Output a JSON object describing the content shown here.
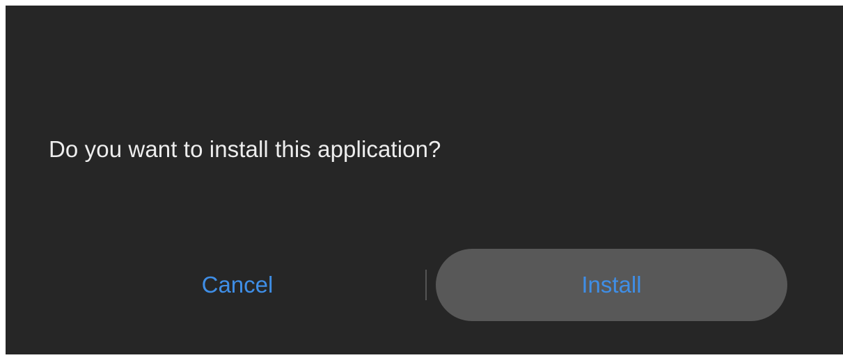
{
  "dialog": {
    "message": "Do you want to install this application?",
    "cancel_label": "Cancel",
    "install_label": "Install"
  },
  "colors": {
    "background": "#262626",
    "message_text": "#ededed",
    "button_text": "#3f8ee6",
    "install_button_fill": "#585858",
    "divider": "#555555"
  }
}
